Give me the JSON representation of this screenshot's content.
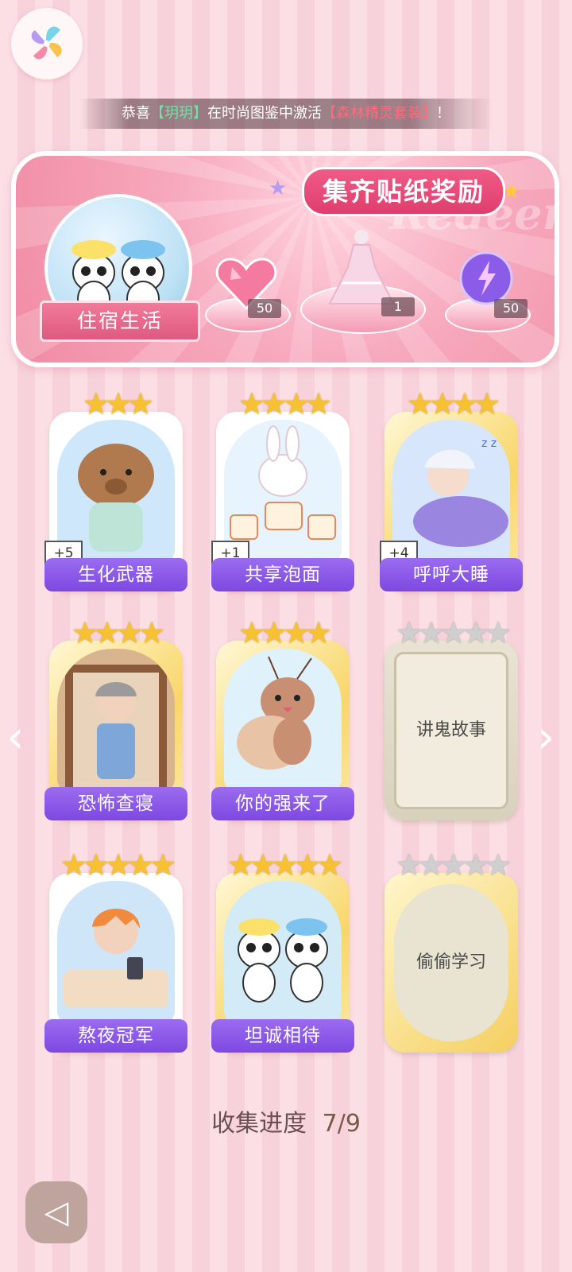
{
  "logo_icon": "pinwheel-logo-icon",
  "ticker": {
    "prefix": "恭喜",
    "name": "【玥玥】",
    "middle": "在时尚图鉴中激活",
    "item": "【森林精灵套装】",
    "suffix": "！"
  },
  "banner": {
    "title": "集齐贴纸奖励",
    "watermark": "Redeem",
    "theme_label": "住宿生活",
    "rewards": [
      {
        "icon": "pink-heart-gem-icon",
        "count": "50"
      },
      {
        "icon": "dress-outfit-icon",
        "count": "1"
      },
      {
        "icon": "purple-energy-orb-icon",
        "count": "50"
      }
    ]
  },
  "cards": [
    {
      "label": "生化武器",
      "stars": 3,
      "plus": "+5",
      "frame": "white",
      "art": "capybara-pajamas"
    },
    {
      "label": "共享泡面",
      "stars": 4,
      "plus": "+1",
      "frame": "white",
      "art": "bunny-instant-noodles"
    },
    {
      "label": "呼呼大睡",
      "stars": 4,
      "plus": "+4",
      "frame": "gold",
      "art": "boy-sleeping-bed"
    },
    {
      "label": "恐怖查寝",
      "stars": 4,
      "plus": "",
      "frame": "gold",
      "art": "dorm-aunt-doorway"
    },
    {
      "label": "你的强来了",
      "stars": 4,
      "plus": "",
      "frame": "gold",
      "art": "cockroach-wave"
    },
    {
      "label": "讲鬼故事",
      "stars": 5,
      "locked": true,
      "frame": "grey"
    },
    {
      "label": "熬夜冠军",
      "stars": 5,
      "plus": "",
      "frame": "white",
      "art": "boy-phone-bed"
    },
    {
      "label": "坦诚相待",
      "stars": 5,
      "plus": "",
      "frame": "gold",
      "art": "pandas-shower"
    },
    {
      "label": "偷偷学习",
      "stars": 5,
      "locked": true,
      "frame": "oval"
    }
  ],
  "nav": {
    "prev_icon": "chevron-left-icon",
    "next_icon": "chevron-right-icon",
    "back_icon": "back-arrow-icon"
  },
  "progress": {
    "label": "收集进度",
    "value": "7/9"
  },
  "colors": {
    "accent_purple": "#8a58e6",
    "banner_pink": "#f08ba4",
    "star_gold": "#f7c232"
  }
}
